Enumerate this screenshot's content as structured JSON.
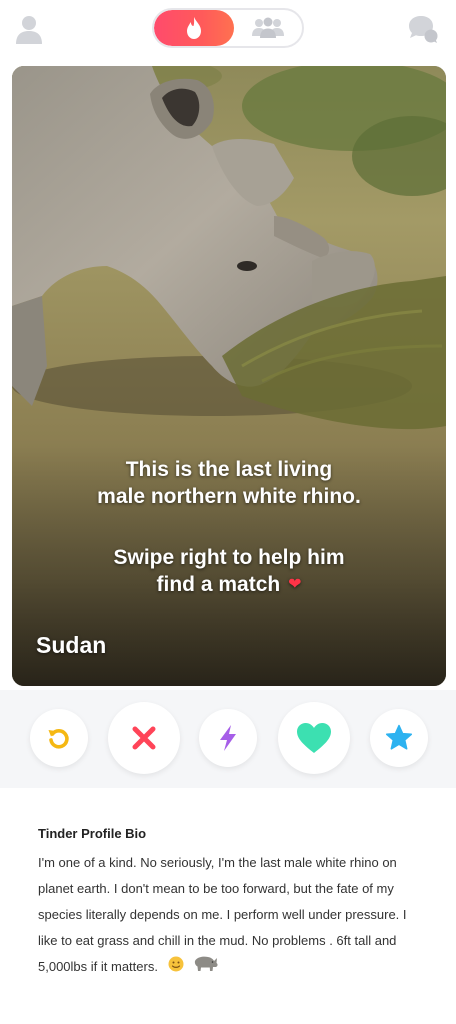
{
  "header": {
    "profile_icon": "profile-icon",
    "discovery_icon": "flame-icon",
    "social_icon": "group-icon",
    "messages_icon": "chat-bubbles-icon",
    "accent_color": "#ff4b6c"
  },
  "card": {
    "caption_line1": "This is the last living",
    "caption_line2": "male northern white rhino.",
    "caption_line3": "Swipe right to help him",
    "caption_line4": "find a match",
    "caption_emoji": "❤",
    "name": "Sudan"
  },
  "actions": {
    "rewind_icon": "rewind-icon",
    "nope_icon": "x-icon",
    "boost_icon": "lightning-icon",
    "like_icon": "heart-icon",
    "superlike_icon": "star-icon",
    "colors": {
      "rewind": "#f5b813",
      "nope": "#ff4458",
      "boost": "#a65ee8",
      "like": "#3ce0b1",
      "superlike": "#2db2f0"
    }
  },
  "bio": {
    "title": "Tinder Profile Bio",
    "text": "I'm one of a kind. No seriously, I'm the last male white rhino on planet earth. I don't mean to be too forward, but the fate of my species literally depends on me. I perform well under pressure. I like to eat grass and chill in the mud. No problems . 6ft tall and 5,000lbs if it matters.",
    "emojis": [
      "smiling-face-icon",
      "rhino-icon"
    ]
  }
}
